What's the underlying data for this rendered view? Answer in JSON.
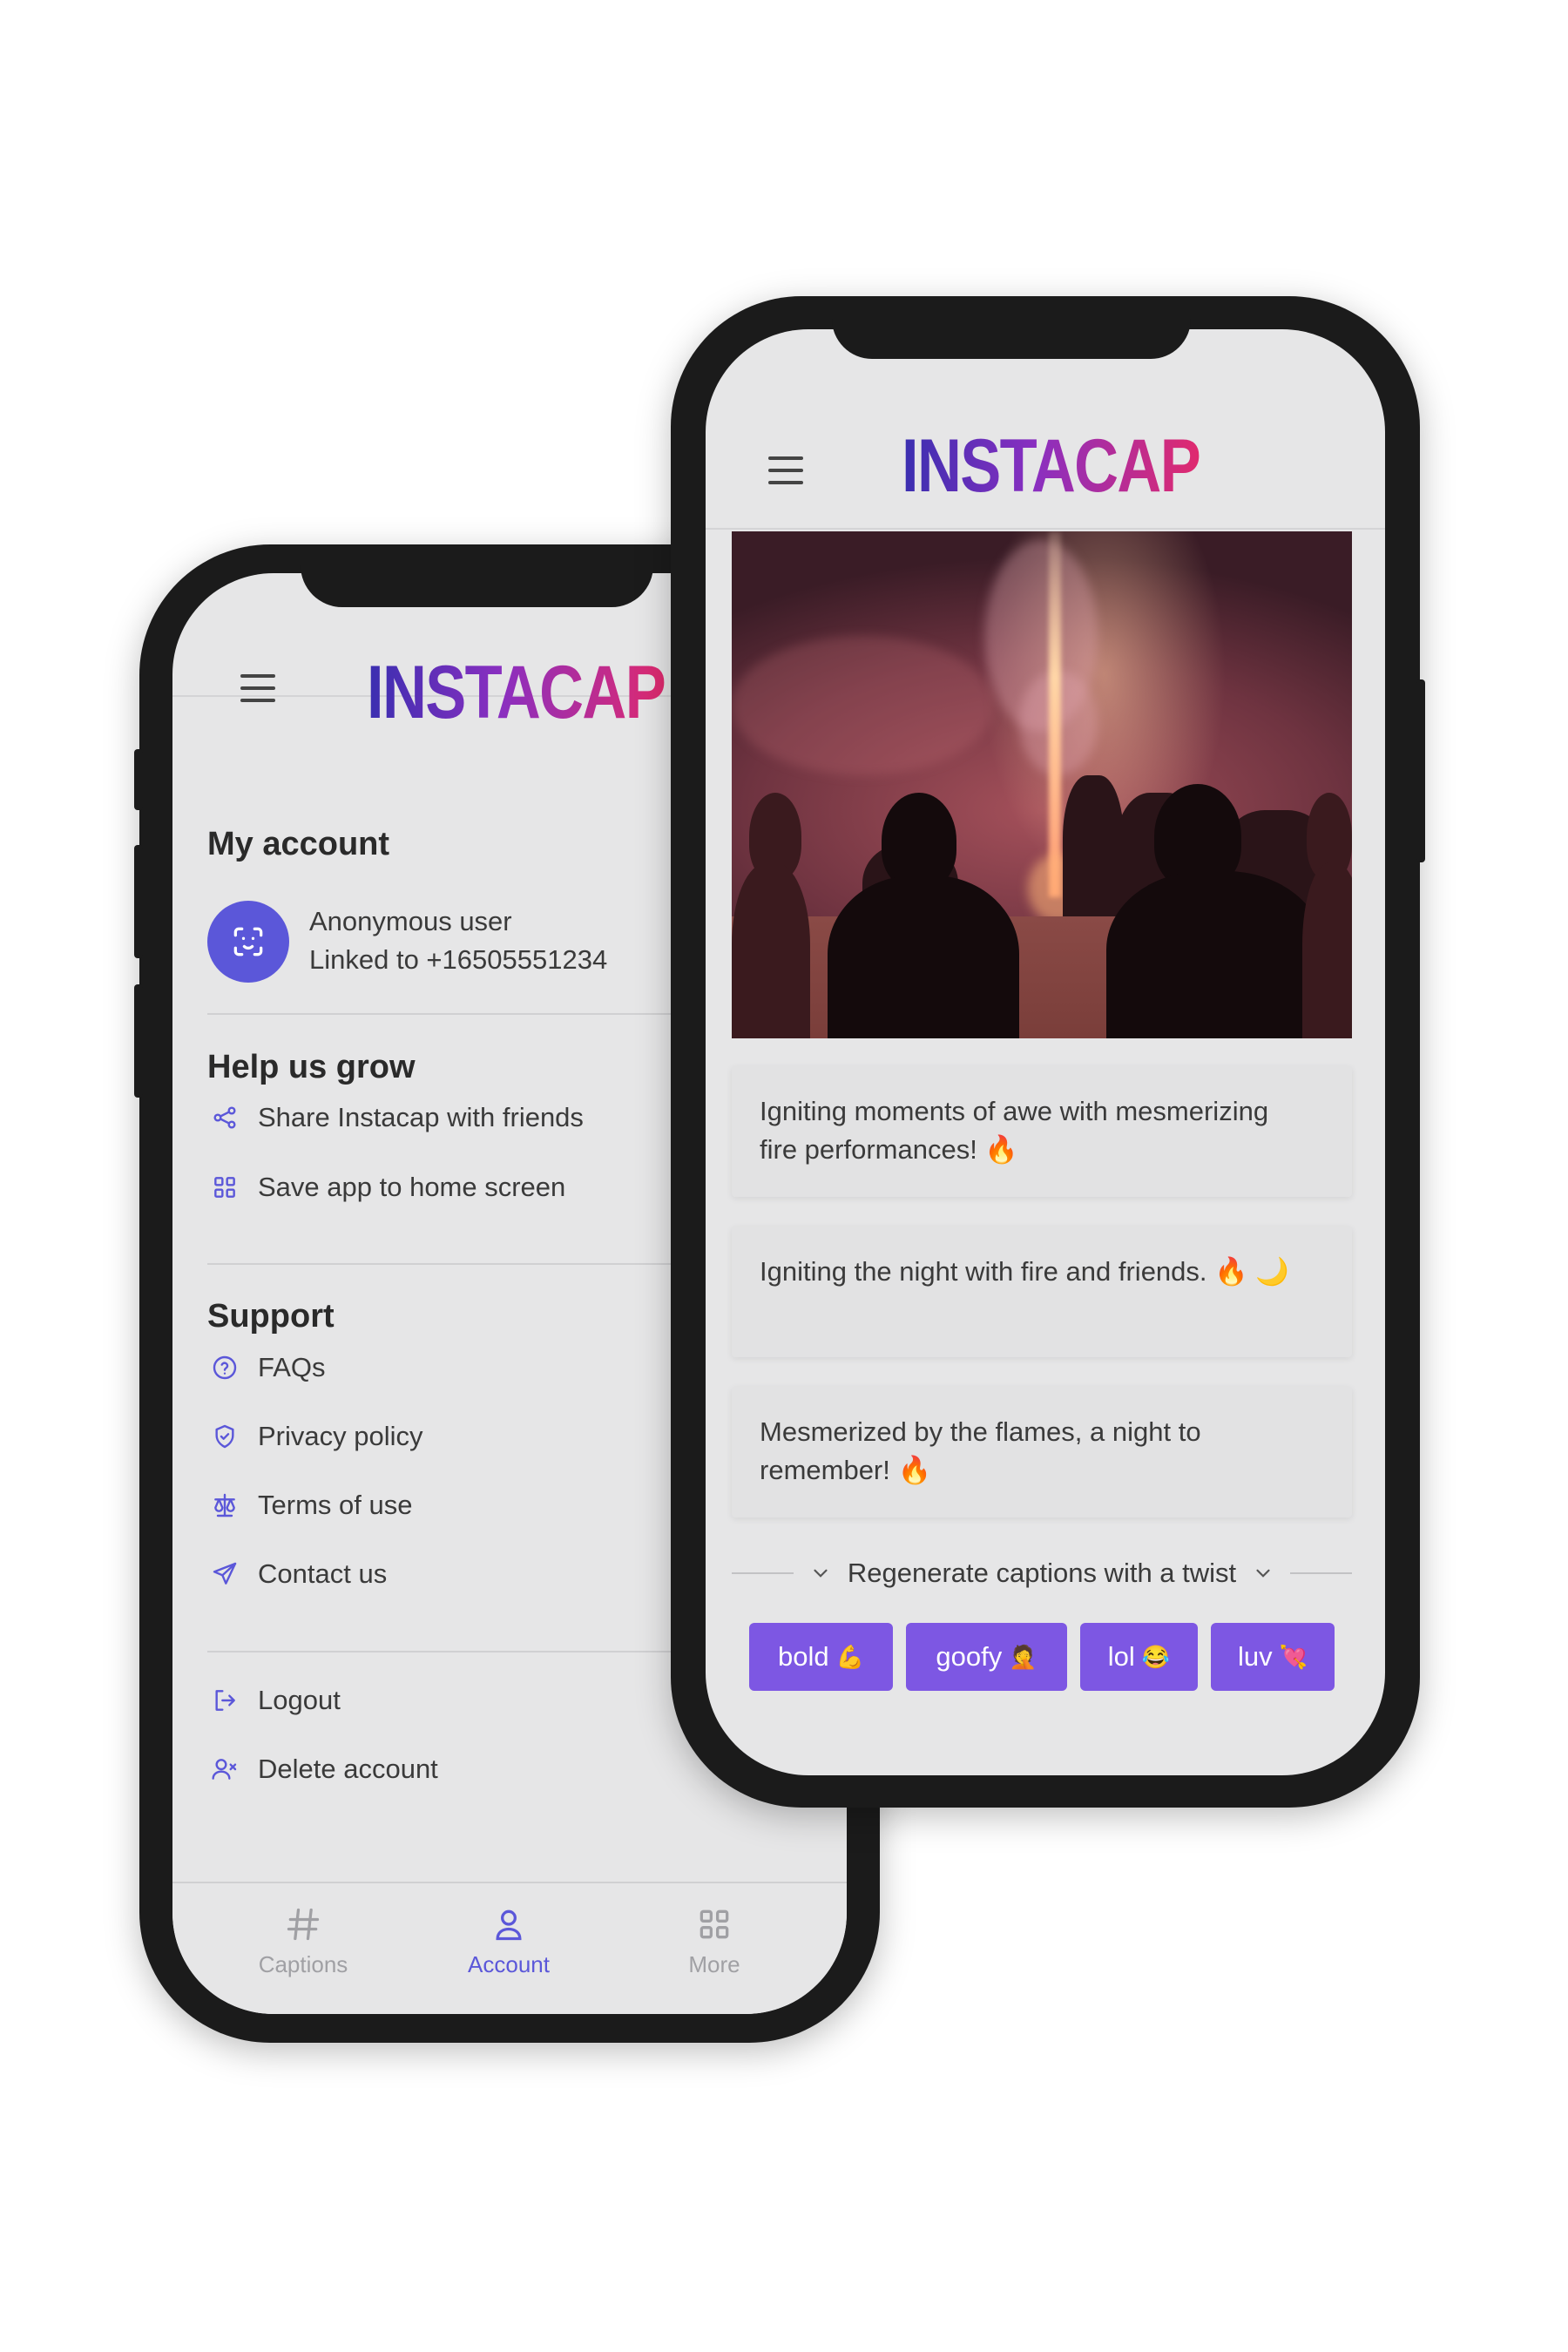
{
  "brand": {
    "logo_text": "INSTACAP",
    "accent_color": "#5b57d9",
    "chip_color": "#7d57e3",
    "logo_gradient": [
      "#3a2fb0",
      "#8a2fc0",
      "#e02a6e"
    ]
  },
  "account_screen": {
    "header": {
      "logo": "INSTACAP",
      "menu_icon": "hamburger-icon"
    },
    "my_account": {
      "title": "My account",
      "user_name": "Anonymous user",
      "user_linked": "Linked to +16505551234",
      "avatar_icon": "face-scan-icon"
    },
    "help_us_grow": {
      "title": "Help us grow",
      "items": [
        {
          "label": "Share Instacap with friends",
          "icon": "share-icon"
        },
        {
          "label": "Save app to home screen",
          "icon": "grid-icon"
        }
      ]
    },
    "support": {
      "title": "Support",
      "items": [
        {
          "label": "FAQs",
          "icon": "question-circle-icon"
        },
        {
          "label": "Privacy policy",
          "icon": "shield-check-icon"
        },
        {
          "label": "Terms of use",
          "icon": "scale-icon"
        },
        {
          "label": "Contact us",
          "icon": "send-icon"
        }
      ]
    },
    "account_actions": {
      "items": [
        {
          "label": "Logout",
          "icon": "logout-icon"
        },
        {
          "label": "Delete account",
          "icon": "user-remove-icon"
        }
      ]
    },
    "tabbar": {
      "tabs": [
        {
          "label": "Captions",
          "icon": "hash-icon",
          "active": false
        },
        {
          "label": "Account",
          "icon": "user-icon",
          "active": true
        },
        {
          "label": "More",
          "icon": "grid-icon",
          "active": false
        }
      ]
    }
  },
  "captions_screen": {
    "header": {
      "logo": "INSTACAP",
      "menu_icon": "hamburger-icon"
    },
    "photo": {
      "description_icon": "photo"
    },
    "captions": [
      {
        "text": "Igniting moments of awe with mesmerizing fire performances! 🔥"
      },
      {
        "text": "Igniting the night with fire and friends. 🔥 🌙"
      },
      {
        "text": "Mesmerized by the flames, a night to remember! 🔥"
      }
    ],
    "regenerate": {
      "label": "Regenerate captions with a twist"
    },
    "chips": [
      {
        "label": "bold",
        "emoji": "💪"
      },
      {
        "label": "goofy",
        "emoji": "🤦"
      },
      {
        "label": "lol",
        "emoji": "😂"
      },
      {
        "label": "luv",
        "emoji": "💘"
      }
    ]
  }
}
